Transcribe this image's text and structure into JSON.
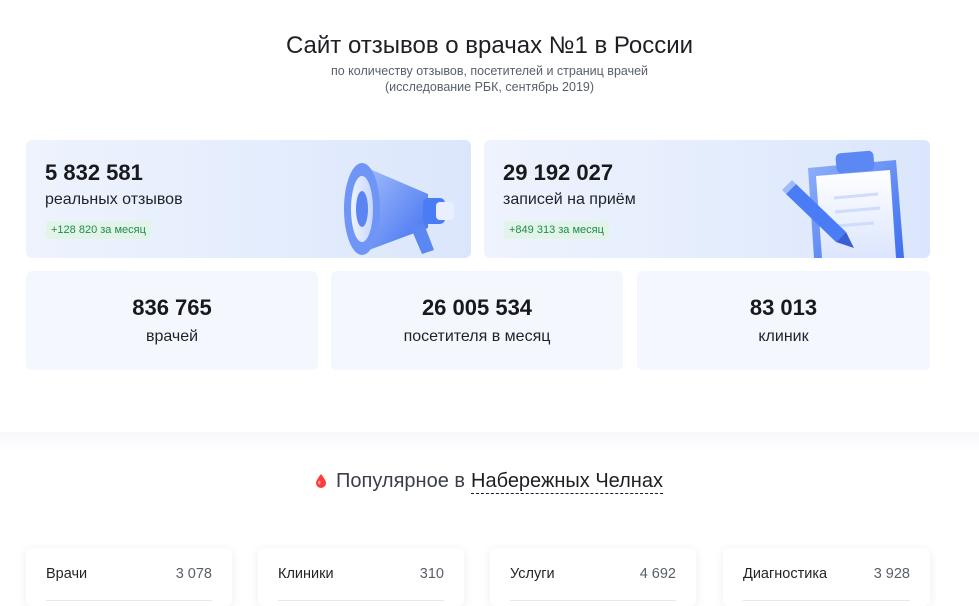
{
  "hero": {
    "title": "Сайт отзывов о врачах №1 в России",
    "subtitle": "по количеству отзывов, посетителей и страниц врачей",
    "note": "(исследование РБК, сентябрь 2019)"
  },
  "stats_big": [
    {
      "value": "5 832 581",
      "label": "реальных отзывов",
      "delta": "+128 820 за месяц",
      "illustration": "megaphone-icon"
    },
    {
      "value": "29 192 027",
      "label": "записей на приём",
      "delta": "+849 313 за месяц",
      "illustration": "clipboard-pen-icon"
    }
  ],
  "stats_small": [
    {
      "value": "836 765",
      "label": "врачей"
    },
    {
      "value": "26 005 534",
      "label": "посетителя в месяц"
    },
    {
      "value": "83 013",
      "label": "клиник"
    }
  ],
  "popular": {
    "prefix": "Популярное в",
    "city": "Набережных Челнах",
    "pin_icon": "location-pin-icon",
    "pin_color": "#ff3b3b"
  },
  "categories": [
    {
      "name": "Врачи",
      "count": "3 078"
    },
    {
      "name": "Клиники",
      "count": "310"
    },
    {
      "name": "Услуги",
      "count": "4 692"
    },
    {
      "name": "Диагностика",
      "count": "3 928"
    }
  ],
  "colors": {
    "accent_blue": "#4a7cf5",
    "delta_green": "#1f8b4f",
    "card_bg": "#f4f7fd"
  }
}
